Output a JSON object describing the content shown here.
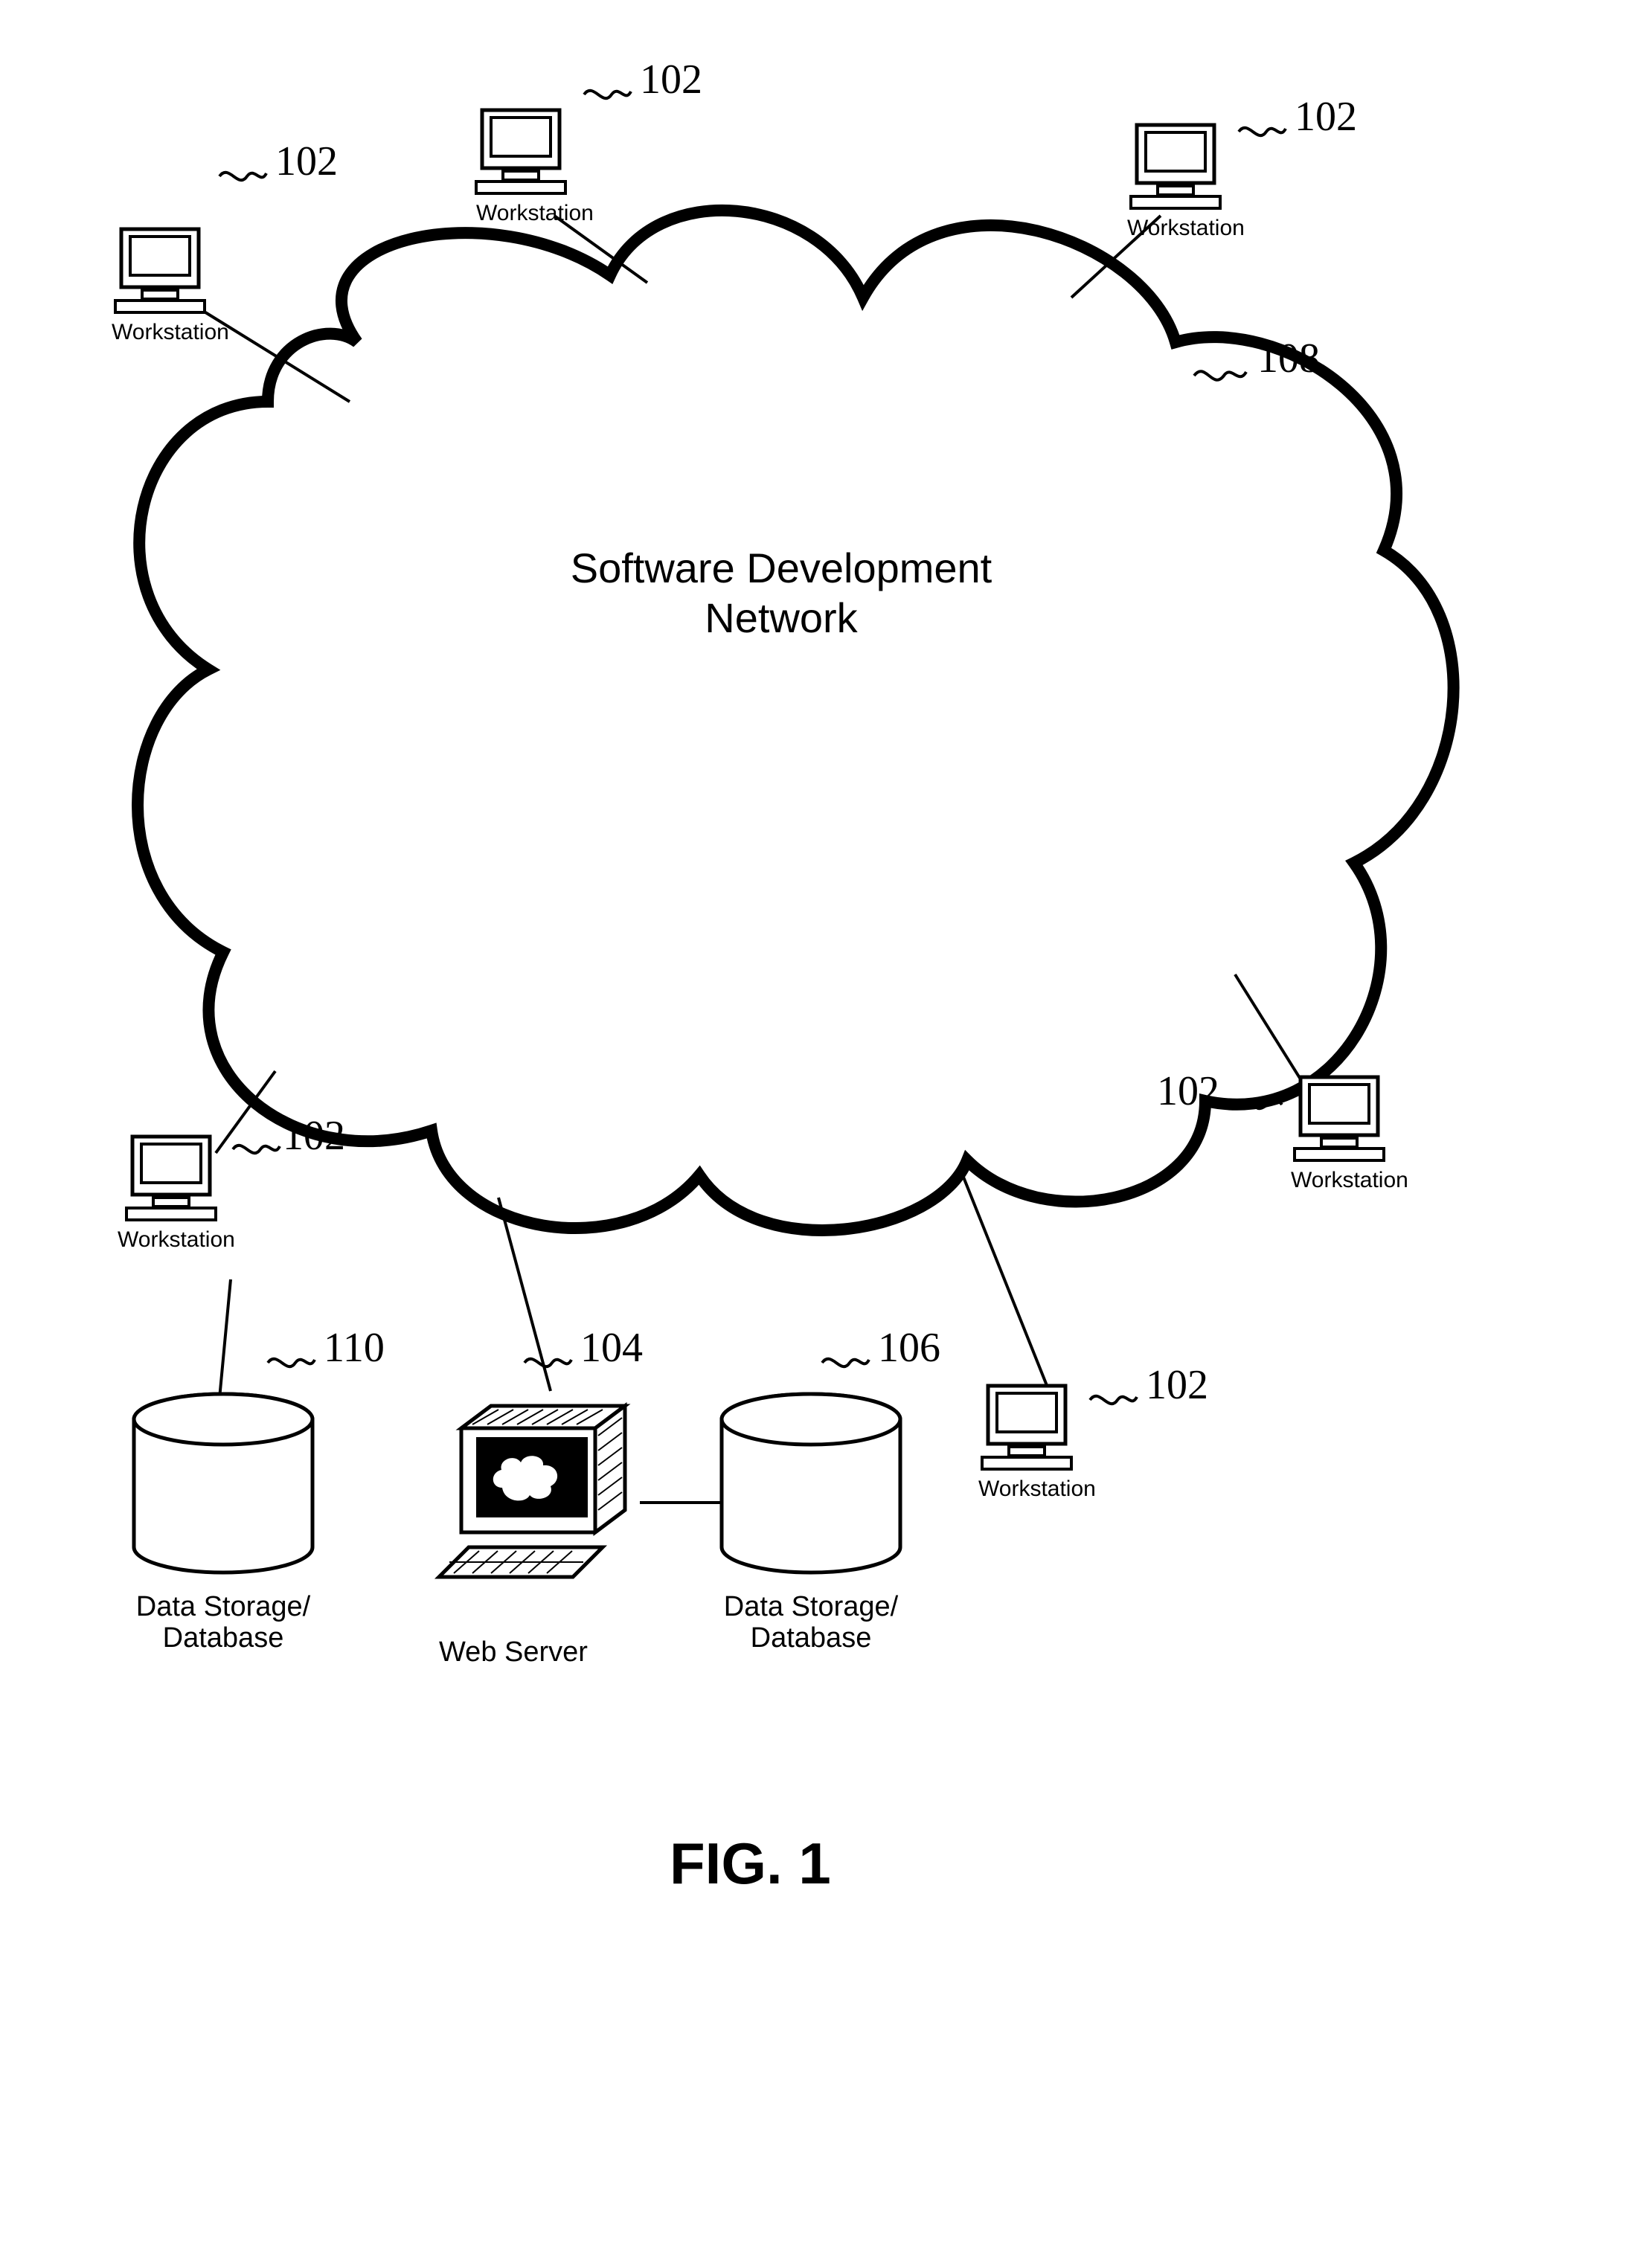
{
  "figure_label": "FIG. 1",
  "cloud": {
    "ref": "108",
    "title_line1": "Software Development",
    "title_line2": "Network"
  },
  "workstations": {
    "label": "Workstation",
    "ref": "102"
  },
  "web_server": {
    "label": "Web Server",
    "ref": "104"
  },
  "database_a": {
    "label_line1": "Data Storage/",
    "label_line2": "Database",
    "ref": "110"
  },
  "database_b": {
    "label_line1": "Data Storage/",
    "label_line2": "Database",
    "ref": "106"
  }
}
